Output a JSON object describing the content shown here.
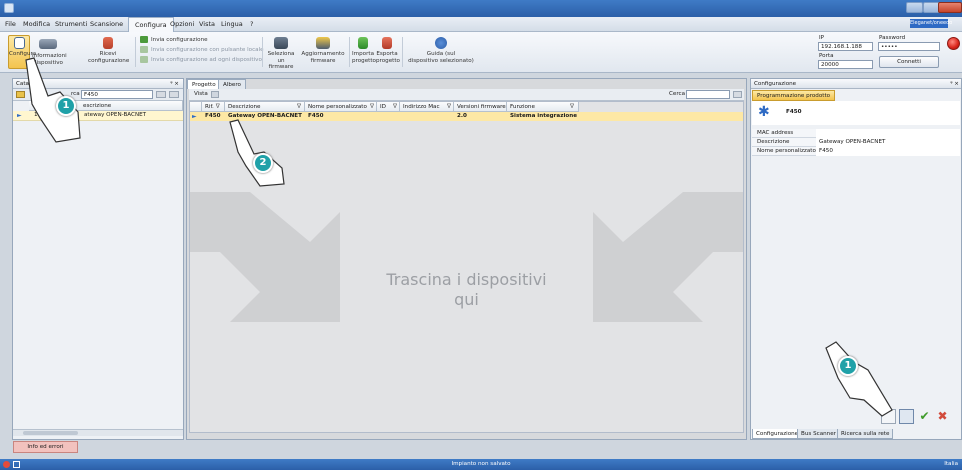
{
  "menubar": {
    "items": [
      "File",
      "Modifica",
      "Strumenti",
      "Scansione",
      "Configura",
      "Opzioni",
      "Vista",
      "Lingua",
      "?"
    ],
    "active": "Configura",
    "user": "Eleganet/oneedo"
  },
  "ribbon": {
    "configura": "Configura",
    "informazioni": [
      "Informazioni",
      "dispositivo"
    ],
    "ricevi": [
      "Ricevi",
      "configurazione"
    ],
    "invia": "Invia configurazione",
    "invia_pulsante": "Invia configurazione con pulsante locale",
    "invia_ogni": "Invia configurazione ad ogni dispositivo",
    "seleziona": [
      "Seleziona",
      "un firmware"
    ],
    "aggiornamento": [
      "Aggiornamento",
      "firmware"
    ],
    "importa": [
      "Importa",
      "progetto"
    ],
    "esporta": [
      "Esporta",
      "progetto"
    ],
    "guida": [
      "Guida (sul",
      "dispositivo selezionato)"
    ]
  },
  "connection": {
    "ip_label": "IP",
    "ip_value": "192.168.1.188",
    "password_label": "Password",
    "password_value": "•••••",
    "porta_label": "Porta",
    "porta_value": "20000",
    "connect": "Connetti"
  },
  "catalog": {
    "title": "Catal",
    "search_label": "rca",
    "search_value": "F450",
    "col_q": "Q.",
    "col_descr": "escrizione",
    "row_q": "1",
    "row_descr": "ateway OPEN-BACNET",
    "pin": "ᵠ ×",
    "info_button": "Info ed errori"
  },
  "project": {
    "tabs": [
      "Progetto",
      "Albero"
    ],
    "vista": "Vista",
    "cerca": "Cerca",
    "columns": [
      "Rif.",
      "Descrizione",
      "Nome personalizzato",
      "ID",
      "Indirizzo Mac",
      "Versioni firmware",
      "Funzione"
    ],
    "row": [
      "F450",
      "Gateway OPEN-BACNET",
      "F450",
      "",
      "",
      "2.0",
      "Sistema integrazione"
    ],
    "drop_hint_line1": "Trascina i dispositivi",
    "drop_hint_line2": "qui"
  },
  "config": {
    "title": "Configurazione",
    "pin": "ᵠ ×",
    "tab": "Programmazione prodotto",
    "device": "F450",
    "props": [
      {
        "key": "MAC address",
        "value": ""
      },
      {
        "key": "Descrizione",
        "value": "Gateway OPEN-BACNET"
      },
      {
        "key": "Nome personalizzato",
        "value": "F450"
      }
    ],
    "bottom_tabs": [
      "Configurazione",
      "Bus Scanner",
      "Ricerca sulla rete"
    ]
  },
  "callouts": [
    "1",
    "2",
    "1"
  ],
  "status": {
    "center": "Impianto non salvato",
    "right": "Italia"
  }
}
